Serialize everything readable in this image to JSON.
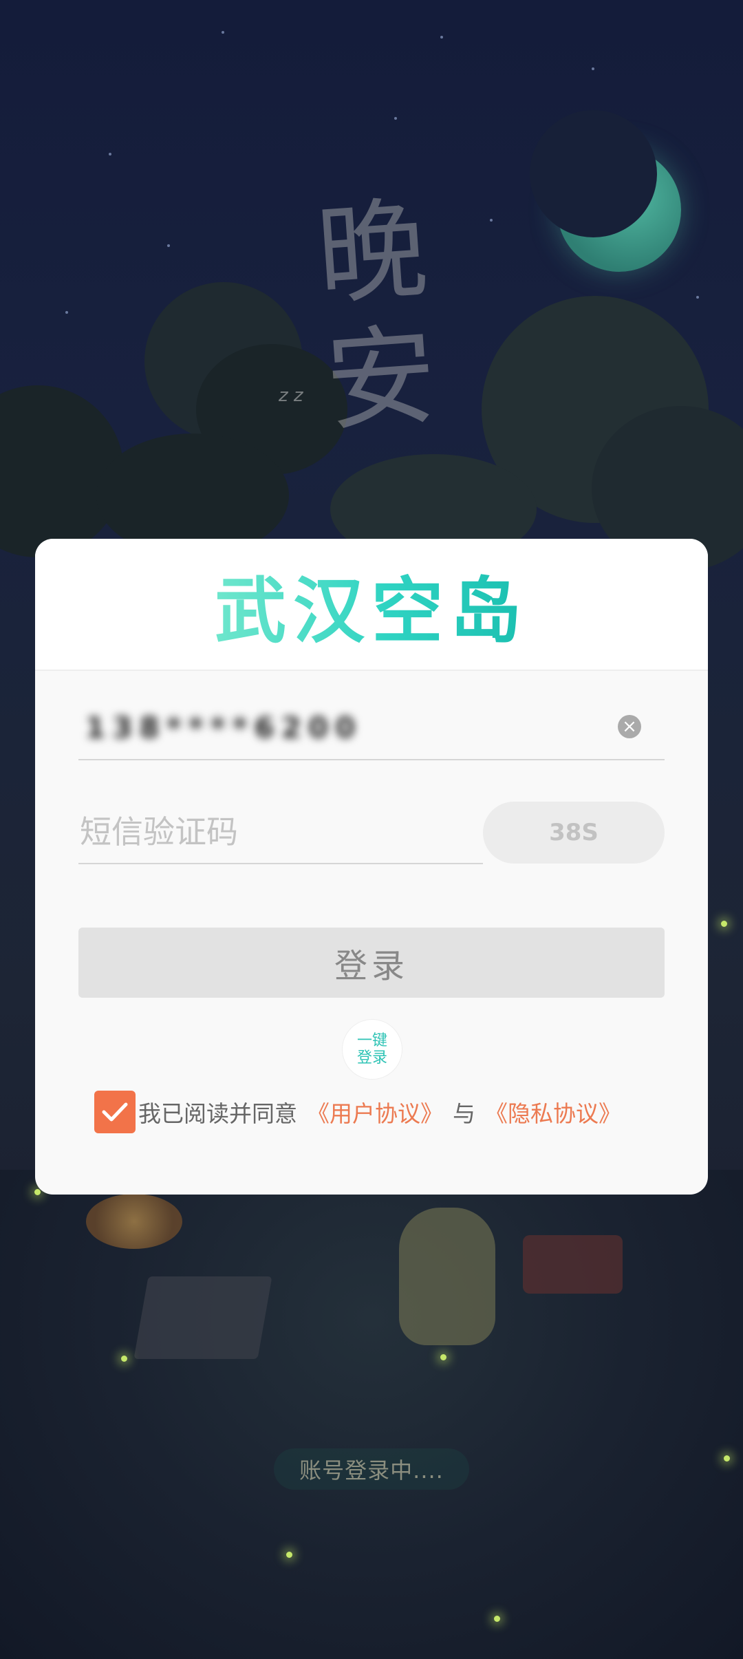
{
  "app": {
    "title": "武汉空岛"
  },
  "background": {
    "title_art": "晚安",
    "status_text": "账号登录中...."
  },
  "login": {
    "phone_value": "138****6200",
    "code_placeholder": "短信验证码",
    "countdown_label": "38S",
    "login_label": "登录",
    "onekey_line1": "一键",
    "onekey_line2": "登录"
  },
  "agreement": {
    "checked": true,
    "prefix": "我已阅读并同意",
    "user_agreement": "《用户协议》",
    "conjunction": "与",
    "privacy_policy": "《隐私协议》"
  },
  "colors": {
    "accent": "#2fd3c2",
    "checkbox": "#f27349",
    "link": "#ec7a51"
  }
}
